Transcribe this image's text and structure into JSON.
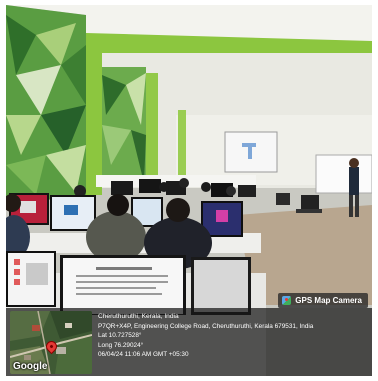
{
  "gps_badge": {
    "label": "GPS Map Camera",
    "icon": "map-pin-icon"
  },
  "map": {
    "logo": "Google"
  },
  "location": {
    "city": "Cheruthuruthi, Kerala, India",
    "address": "P7QR+X4P, Engineering College Road, Cheruthuruthi, Kerala 679531, India",
    "lat": "Lat 10.727528°",
    "long": "Long 76.29024°",
    "datetime": "06/04/24 11:06 AM GMT +05:30"
  },
  "colors": {
    "lime_accent": "#8cc63f",
    "ceiling": "#f2f2ec",
    "floor": "#b7a58e",
    "wall_green": "#4f9a3c"
  }
}
